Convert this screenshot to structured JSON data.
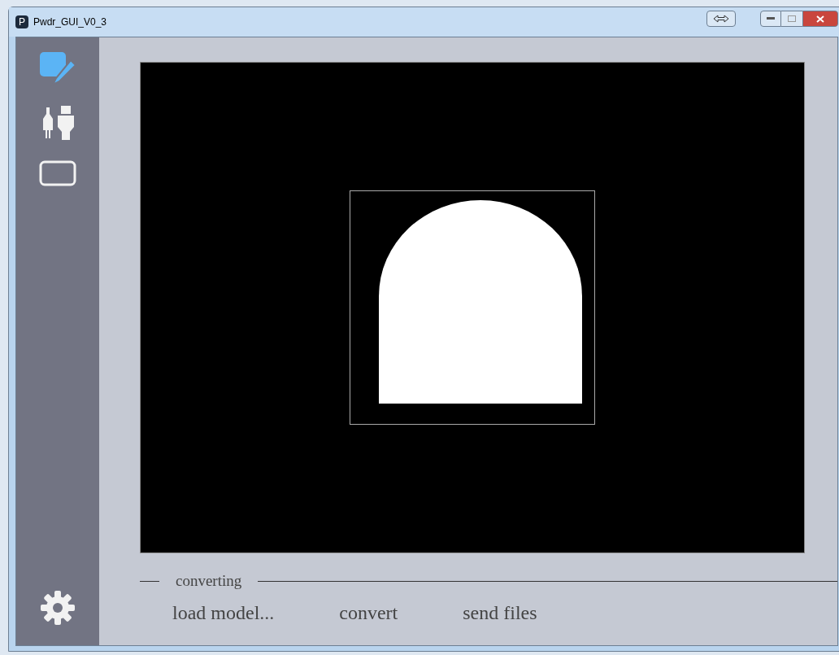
{
  "window": {
    "icon_letter": "P",
    "title": "Pwdr_GUI_V0_3"
  },
  "sidebar": {
    "items": [
      {
        "kind": "edit",
        "selected": true
      },
      {
        "kind": "plugs",
        "selected": false
      },
      {
        "kind": "screen",
        "selected": false
      }
    ]
  },
  "converting": {
    "label": "converting",
    "buttons": [
      "load model...",
      "convert",
      "send files"
    ]
  }
}
